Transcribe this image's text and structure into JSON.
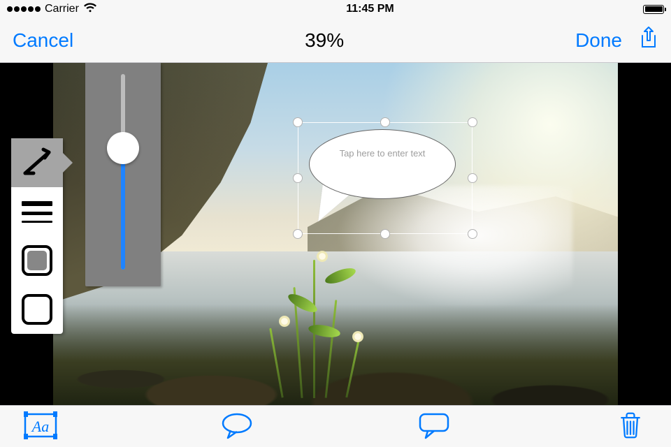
{
  "status": {
    "carrier": "Carrier",
    "time": "11:45 PM"
  },
  "nav": {
    "cancel": "Cancel",
    "title": "39%",
    "done": "Done"
  },
  "bubble": {
    "placeholder": "Tap here to enter text"
  },
  "slider": {
    "value_pct": 62
  },
  "tools": {
    "active": "angle"
  },
  "bottom": {
    "active": "text"
  },
  "colors": {
    "tint": "#007aff"
  }
}
